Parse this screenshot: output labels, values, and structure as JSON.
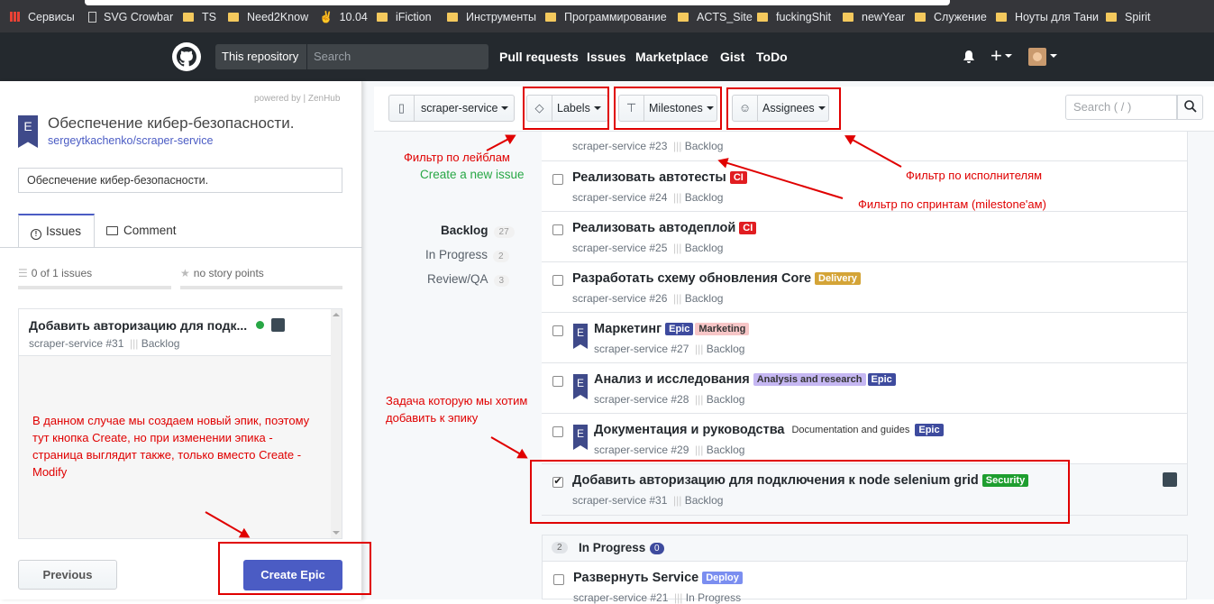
{
  "bookmarks": [
    {
      "label": "Сервисы",
      "icon": "apps-icon"
    },
    {
      "label": "SVG Crowbar",
      "icon": "page-icon"
    },
    {
      "label": "TS",
      "icon": "folder-icon"
    },
    {
      "label": "Need2Know",
      "icon": "folder-icon"
    },
    {
      "label": "10.04",
      "icon": "victory-icon"
    },
    {
      "label": "iFiction",
      "icon": "folder-icon"
    },
    {
      "label": "Инструменты",
      "icon": "folder-icon"
    },
    {
      "label": "Программирование",
      "icon": "folder-icon"
    },
    {
      "label": "ACTS_Site",
      "icon": "folder-icon"
    },
    {
      "label": "fuckingShit",
      "icon": "folder-icon"
    },
    {
      "label": "newYear",
      "icon": "folder-icon"
    },
    {
      "label": "Служение",
      "icon": "folder-icon"
    },
    {
      "label": "Ноуты для Тани",
      "icon": "folder-icon"
    },
    {
      "label": "Spirit",
      "icon": "folder-icon"
    }
  ],
  "github": {
    "scope": "This repository",
    "search_placeholder": "Search",
    "nav": [
      "Pull requests",
      "Issues",
      "Marketplace",
      "Gist",
      "ToDo"
    ],
    "plus": "+"
  },
  "sidebar": {
    "powered": "powered by | ZenHub",
    "epic_letter": "E",
    "epic_title": "Обеспечение кибер-безопасности.",
    "repo": "sergeytkachenko/scraper-service",
    "title_input": "Обеспечение кибер-безопасности.",
    "tabs": [
      "Issues",
      "Comment"
    ],
    "issues_count": "0 of 1 issues",
    "story_points": "no story points",
    "issue": {
      "title": "Добавить авторизацию для подк...",
      "sub": "scraper-service #31",
      "pipeline": "Backlog"
    },
    "note": "В данном случае мы создаем новый эпик, поэтому тут кнопка Create, но при изменении эпика - страница выглядит также, только вместо Create - Modify",
    "previous": "Previous",
    "create": "Create Epic"
  },
  "toolbar": {
    "repo": "scraper-service",
    "labels": "Labels",
    "milestones": "Milestones",
    "assignees": "Assignees",
    "search_placeholder": "Search ( / )"
  },
  "filter": {
    "create_link": "Create a new issue",
    "pipelines": [
      {
        "name": "Backlog",
        "count": "27"
      },
      {
        "name": "In Progress",
        "count": "2"
      },
      {
        "name": "Review/QA",
        "count": "3"
      }
    ]
  },
  "issues": [
    {
      "title": "",
      "sub": "scraper-service #23",
      "pipeline": "Backlog",
      "epic": false,
      "checked": false,
      "labels": []
    },
    {
      "title": "Реализовать автотесты",
      "sub": "scraper-service #24",
      "pipeline": "Backlog",
      "epic": false,
      "checked": false,
      "labels": [
        {
          "text": "CI",
          "bg": "#e11d21",
          "fg": "#fff"
        }
      ]
    },
    {
      "title": "Реализовать автодеплой",
      "sub": "scraper-service #25",
      "pipeline": "Backlog",
      "epic": false,
      "checked": false,
      "labels": [
        {
          "text": "CI",
          "bg": "#e11d21",
          "fg": "#fff"
        }
      ]
    },
    {
      "title": "Разработать схему обновления Core",
      "sub": "scraper-service #26",
      "pipeline": "Backlog",
      "epic": false,
      "checked": false,
      "labels": [
        {
          "text": "Delivery",
          "bg": "#d4a437",
          "fg": "#fff"
        }
      ]
    },
    {
      "title": "Маркетинг",
      "sub": "scraper-service #27",
      "pipeline": "Backlog",
      "epic": true,
      "checked": false,
      "labels": [
        {
          "text": "Epic",
          "bg": "#3e4b9e",
          "fg": "#fff"
        },
        {
          "text": "Marketing",
          "bg": "#f7c6c7",
          "fg": "#333"
        }
      ]
    },
    {
      "title": "Анализ и исследования",
      "sub": "scraper-service #28",
      "pipeline": "Backlog",
      "epic": true,
      "checked": false,
      "labels": [
        {
          "text": "Analysis and research",
          "bg": "#c5b7f2",
          "fg": "#333"
        },
        {
          "text": "Epic",
          "bg": "#3e4b9e",
          "fg": "#fff"
        }
      ]
    },
    {
      "title": "Документация и руководства",
      "sub": "scraper-service #29",
      "pipeline": "Backlog",
      "epic": true,
      "checked": false,
      "labels": [
        {
          "text": "Documentation and guides",
          "bg": "#ffffff",
          "fg": "#333"
        },
        {
          "text": "Epic",
          "bg": "#3e4b9e",
          "fg": "#fff"
        }
      ]
    },
    {
      "title": "Добавить авторизацию для подключения к node selenium grid",
      "sub": "scraper-service #31",
      "pipeline": "Backlog",
      "epic": false,
      "checked": true,
      "labels": [
        {
          "text": "Security",
          "bg": "#1e9e2f",
          "fg": "#fff"
        }
      ]
    }
  ],
  "in_progress": {
    "count": "2",
    "name": "In Progress",
    "badge": "0"
  },
  "ip_issue": {
    "title": "Развернуть Service",
    "sub": "scraper-service #21",
    "pipeline": "In Progress",
    "label": {
      "text": "Deploy",
      "bg": "#7b8ef0",
      "fg": "#fff"
    }
  },
  "annotations": {
    "labels": "Фильтр по лейблам",
    "assignees": "Фильтр по исполнителям",
    "milestones": "Фильтр по спринтам (milestone'ам)",
    "task": "Задача которую мы хотим добавить к эпику"
  },
  "colors": {
    "accent": "#4b5cc4",
    "annotation": "#e00000",
    "header": "#24292e"
  }
}
